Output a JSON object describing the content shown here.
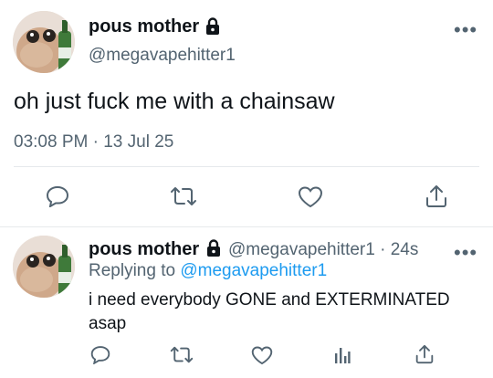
{
  "tweet": {
    "display_name": "pous mother",
    "handle": "@megavapehitter1",
    "more_icon": "more-icon",
    "text": "oh just fuck me with a chainsaw",
    "timestamp": "03:08 PM · 13 Jul 25",
    "locked": true,
    "actions": [
      "reply-icon",
      "retweet-icon",
      "like-icon",
      "share-icon"
    ]
  },
  "reply": {
    "display_name": "pous mother",
    "handle": "@megavapehitter1",
    "age": "· 24s",
    "replying_label": "Replying to",
    "replying_to": "@megavapehitter1",
    "text": "i need everybody GONE and EXTERMINATED asap",
    "actions": [
      "reply-icon",
      "retweet-icon",
      "like-icon",
      "stats-icon",
      "share-icon"
    ]
  },
  "colors": {
    "text": "#0f1419",
    "muted": "#536471",
    "link": "#1d9bf0",
    "divider": "#e6e9ec"
  }
}
